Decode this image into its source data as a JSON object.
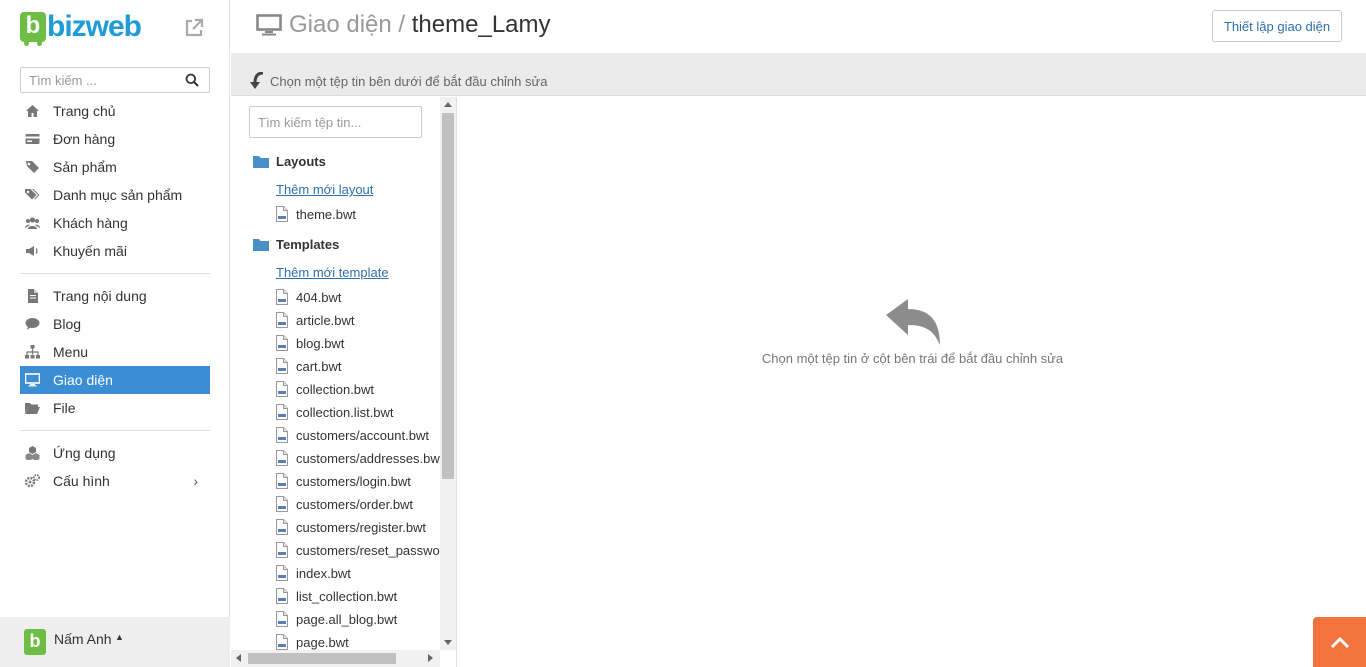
{
  "app": {
    "logo_text": "bizweb",
    "logo_badge": "b"
  },
  "sidebar": {
    "search_placeholder": "Tìm kiếm ...",
    "group1": [
      {
        "label": "Trang chủ",
        "icon": "home-icon"
      },
      {
        "label": "Đơn hàng",
        "icon": "credit-card-icon"
      },
      {
        "label": "Sản phẩm",
        "icon": "tag-icon"
      },
      {
        "label": "Danh mục sản phẩm",
        "icon": "tags-icon"
      },
      {
        "label": "Khách hàng",
        "icon": "users-icon"
      },
      {
        "label": "Khuyến mãi",
        "icon": "megaphone-icon"
      }
    ],
    "group2": [
      {
        "label": "Trang nội dung",
        "icon": "file-icon"
      },
      {
        "label": "Blog",
        "icon": "comment-icon"
      },
      {
        "label": "Menu",
        "icon": "sitemap-icon"
      },
      {
        "label": "Giao diện",
        "icon": "monitor-icon",
        "active": true
      },
      {
        "label": "File",
        "icon": "folder-open-icon"
      }
    ],
    "group3": [
      {
        "label": "Ứng dụng",
        "icon": "cubes-icon"
      },
      {
        "label": "Cấu hình",
        "icon": "cogs-icon",
        "chevron": "›"
      }
    ],
    "user": {
      "name": "Nấm Anh",
      "caret": "▲",
      "avatar_letter": "b"
    },
    "active_color": "#3c8ed4"
  },
  "header": {
    "breadcrumb": "Giao diện",
    "separator": "/",
    "current": "theme_Lamy",
    "setup_button": "Thiết lập giao diện"
  },
  "infobar": {
    "text": "Chọn một tệp tin bên dưới để bắt đầu chỉnh sửa"
  },
  "files": {
    "search_placeholder": "Tìm kiếm tệp tin...",
    "layouts": {
      "title": "Layouts",
      "add_link": "Thêm mới layout",
      "items": [
        "theme.bwt"
      ]
    },
    "templates": {
      "title": "Templates",
      "add_link": "Thêm mới template",
      "items": [
        "404.bwt",
        "article.bwt",
        "blog.bwt",
        "cart.bwt",
        "collection.bwt",
        "collection.list.bwt",
        "customers/account.bwt",
        "customers/addresses.bwt",
        "customers/login.bwt",
        "customers/order.bwt",
        "customers/register.bwt",
        "customers/reset_password.bwt",
        "index.bwt",
        "list_collection.bwt",
        "page.all_blog.bwt",
        "page.bwt"
      ]
    }
  },
  "editor": {
    "empty_message": "Chọn một tệp tin ở cột bên trái để bắt đầu chỉnh sửa"
  },
  "colors": {
    "brand_green": "#6ebd44",
    "brand_blue": "#1f9bd7",
    "link": "#2f6fab",
    "totop": "#f2733b"
  }
}
